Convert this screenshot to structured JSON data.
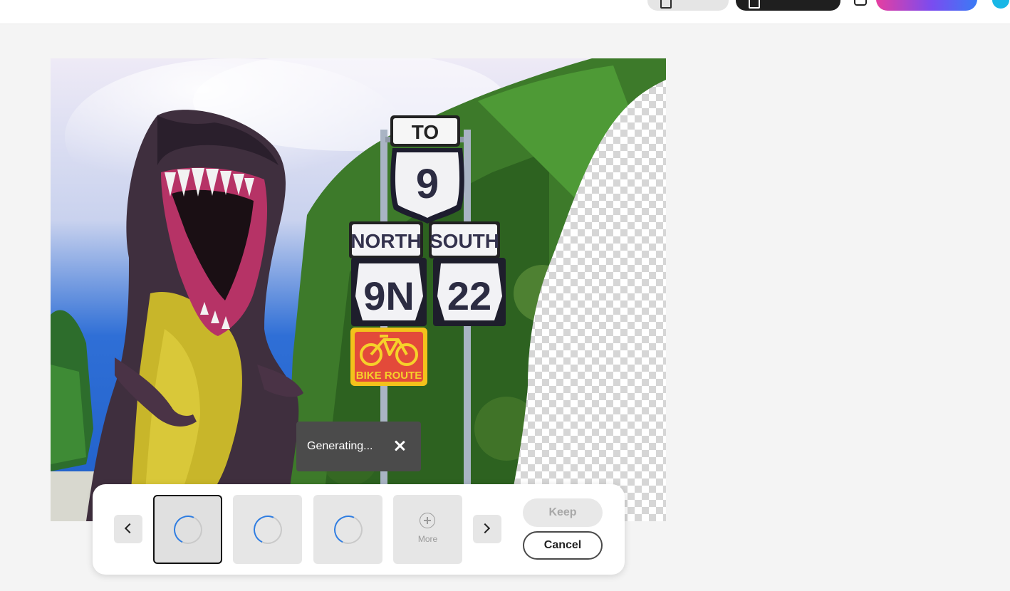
{
  "topbar": {
    "buttons": [
      "file-button",
      "share-button",
      "comment-icon",
      "upgrade-button",
      "avatar"
    ],
    "colors": {
      "upgrade_gradient": [
        "#e63ea0",
        "#7a4cf0",
        "#3a7bf5"
      ],
      "avatar": "#19b7e6"
    }
  },
  "canvas": {
    "signs": {
      "to": "TO",
      "route_us": "9",
      "north": "NORTH",
      "south": "SOUTH",
      "route_left": "9N",
      "route_right": "22",
      "bike": "BIKE ROUTE"
    }
  },
  "toast": {
    "text": "Generating...",
    "close_icon": "close-icon"
  },
  "panel": {
    "more_label": "More",
    "keep_label": "Keep",
    "cancel_label": "Cancel",
    "thumbnails": [
      {
        "state": "loading",
        "selected": true
      },
      {
        "state": "loading",
        "selected": false
      },
      {
        "state": "loading",
        "selected": false
      }
    ],
    "colors": {
      "spinner": "#2f7de1"
    }
  }
}
